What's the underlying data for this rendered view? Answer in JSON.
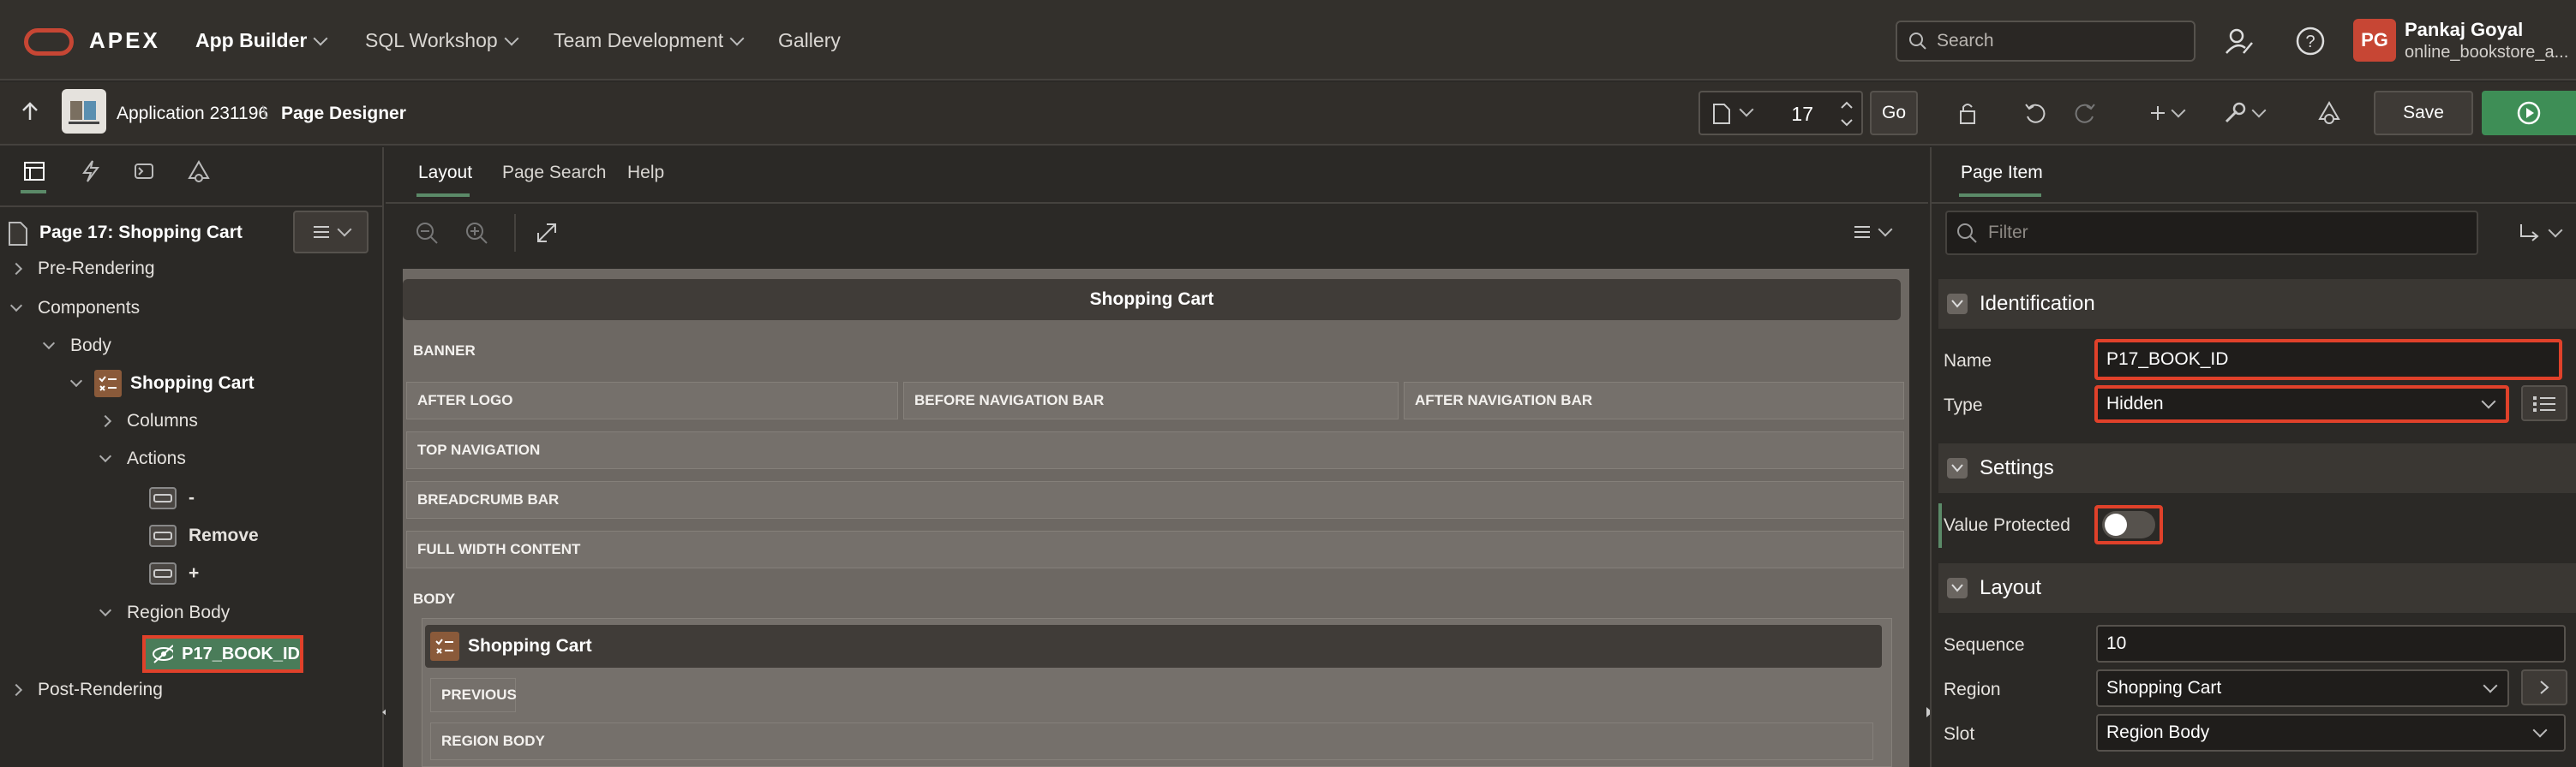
{
  "topnav": {
    "brand": "APEX",
    "items": [
      {
        "label": "App Builder"
      },
      {
        "label": "SQL Workshop"
      },
      {
        "label": "Team Development"
      },
      {
        "label": "Gallery"
      }
    ],
    "search_placeholder": "Search",
    "user_initials": "PG",
    "user_name": "Pankaj Goyal",
    "user_workspace": "online_bookstore_a..."
  },
  "toolbar": {
    "app_label": "Application 231196",
    "separator": "\\",
    "page_designer": "Page Designer",
    "page_number": "17",
    "go_label": "Go",
    "save_label": "Save"
  },
  "left": {
    "page_title": "Page 17: Shopping Cart",
    "tree": {
      "pre_rendering": "Pre-Rendering",
      "components": "Components",
      "body": "Body",
      "shopping_cart": "Shopping Cart",
      "columns": "Columns",
      "actions": "Actions",
      "btn_minus": "-",
      "btn_remove": "Remove",
      "btn_plus": "+",
      "region_body": "Region Body",
      "item": "P17_BOOK_ID",
      "post_rendering": "Post-Rendering"
    }
  },
  "center": {
    "tabs": [
      "Layout",
      "Page Search",
      "Help"
    ],
    "page_title": "Shopping Cart",
    "slots": {
      "banner": "BANNER",
      "after_logo": "AFTER LOGO",
      "before_nav": "BEFORE NAVIGATION BAR",
      "after_nav": "AFTER NAVIGATION BAR",
      "top_nav": "TOP NAVIGATION",
      "breadcrumb": "BREADCRUMB BAR",
      "full_width": "FULL WIDTH CONTENT",
      "body": "BODY",
      "region_title": "Shopping Cart",
      "previous": "PREVIOUS",
      "region_body": "REGION BODY"
    }
  },
  "right": {
    "tab": "Page Item",
    "filter_placeholder": "Filter",
    "sections": {
      "identification": "Identification",
      "settings": "Settings",
      "layout": "Layout"
    },
    "props": {
      "name_label": "Name",
      "name_value": "P17_BOOK_ID",
      "type_label": "Type",
      "type_value": "Hidden",
      "value_protected_label": "Value Protected",
      "value_protected": false,
      "sequence_label": "Sequence",
      "sequence_value": "10",
      "region_label": "Region",
      "region_value": "Shopping Cart",
      "slot_label": "Slot",
      "slot_value": "Region Body"
    }
  },
  "colors": {
    "accent_red": "#c74634",
    "highlight": "#e0412a",
    "run_green": "#3e8e56"
  }
}
